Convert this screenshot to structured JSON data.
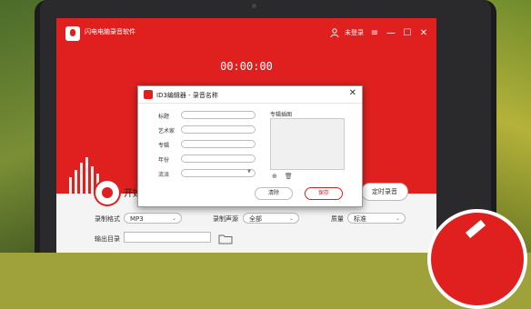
{
  "app": {
    "title": "闪电电脑录音软件",
    "login_label": "未登录",
    "timer": "00:00:00"
  },
  "controls": {
    "start_label": "开始",
    "timed_record_label": "定时录音"
  },
  "settings": {
    "format_label": "录制格式",
    "format_value": "MP3",
    "source_label": "录制声源",
    "source_value": "全部",
    "quality_label": "质量",
    "quality_value": "标准",
    "output_label": "输出目录"
  },
  "dialog": {
    "title": "ID3编辑器 - 录音名称",
    "fields": [
      {
        "label": "标题"
      },
      {
        "label": "艺术家"
      },
      {
        "label": "专辑"
      },
      {
        "label": "年份"
      }
    ],
    "genre_label": "流派",
    "cover_label": "专辑插图",
    "clear_label": "清除",
    "save_label": "保存"
  },
  "colors": {
    "brand_red": "#e0201f"
  }
}
